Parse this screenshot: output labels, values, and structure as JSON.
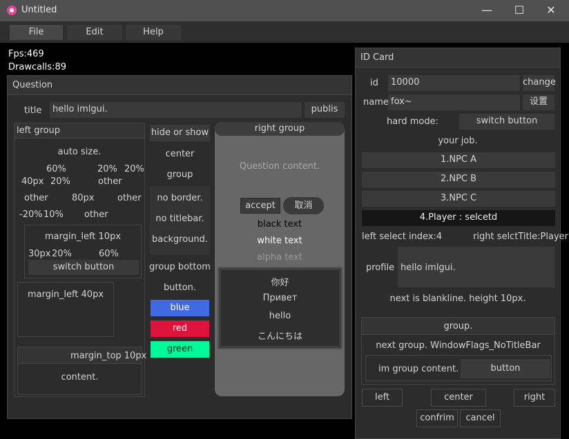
{
  "window": {
    "title": "Untitled",
    "minimize": "—",
    "maximize": "☐",
    "close": "✕"
  },
  "menu": [
    "File",
    "Edit",
    "Help"
  ],
  "stats": {
    "fps": "Fps:469",
    "drawcalls": "Drawcalls:89"
  },
  "question": {
    "title": "Question",
    "title_label": "title",
    "title_value": "hello imlgui.",
    "publish": "publis",
    "left_group": {
      "title": "left group",
      "auto_size": "auto size.",
      "row1": [
        "60%",
        "20%",
        "20%"
      ],
      "row2": [
        "40px",
        "20%",
        "other"
      ],
      "row3": [
        "other",
        "80px",
        "other"
      ],
      "row4": [
        "-20%",
        "10%",
        "other"
      ],
      "margin_left_10": "margin_left 10px",
      "row5": [
        "30px",
        "20%",
        "60%"
      ],
      "switch_button": "switch button",
      "margin_left_40": "margin_left 40px",
      "margin_top_10": "margin_top 10px",
      "content": "content."
    },
    "middle": {
      "hide_or_show": "hide or show",
      "center": "center",
      "group": "group",
      "no_border": "no border.",
      "no_titlebar": "no titlebar.",
      "background": "background.",
      "group_bottom": "group bottom",
      "button": "button.",
      "blue": "blue",
      "red": "red",
      "green": "green"
    },
    "right_group": {
      "title": "right group",
      "content": "Question content.",
      "accept": "accept",
      "cancel": "取消",
      "black_text": "black text",
      "white_text": "white text",
      "alpha_text": "alpha text",
      "langs": [
        "你好",
        "Привет",
        "hello",
        "こんにちは"
      ]
    }
  },
  "id_card": {
    "title": "ID Card",
    "id_label": "id",
    "id_value": "10000",
    "change": "change",
    "name_label": "name",
    "name_value": "fox~",
    "settings": "设置",
    "hard_mode": "hard mode:",
    "switch_button": "switch button",
    "your_job": "your job.",
    "jobs": [
      "1.NPC A",
      "2.NPC B",
      "3.NPC C",
      "4.Player : selcetd"
    ],
    "left_index": "left select index:4",
    "right_title": "right selctTitle:Player",
    "profile_label": "profile",
    "profile_value": "hello imlgui.",
    "blankline": "next is blankline. height 10px.",
    "group_title": "group.",
    "next_group": "next group. WindowFlags_NoTitleBar",
    "im_group_content": "im group content.",
    "button": "button",
    "left": "left",
    "center": "center",
    "right": "right",
    "confirm": "confrim",
    "cancel": "cancel"
  },
  "colors": {
    "blue": "#4169e1",
    "red": "#dc143c",
    "green": "#00fa9a",
    "accent": "#e8459a"
  }
}
